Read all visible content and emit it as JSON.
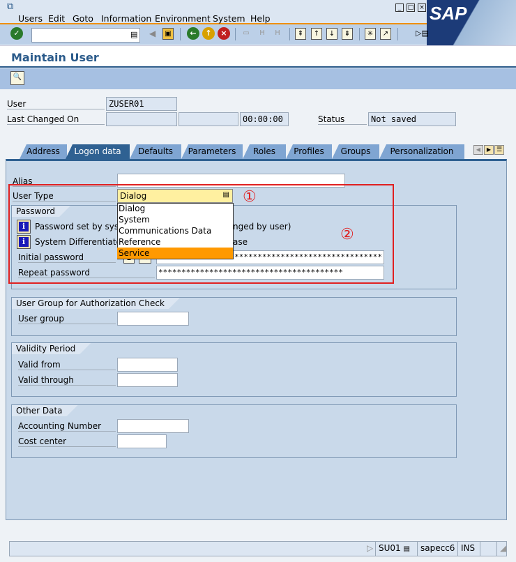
{
  "menu": [
    "Users",
    "Edit",
    "Goto",
    "Information",
    "Environment",
    "System",
    "Help"
  ],
  "logo": "SAP",
  "command_field": "",
  "page_title": "Maintain User",
  "header_fields": {
    "user_label": "User",
    "user_value": "ZUSER01",
    "last_changed_label": "Last Changed On",
    "last_changed_date": "",
    "last_changed_by": "",
    "last_changed_time": "00:00:00",
    "status_label": "Status",
    "status_value": "Not saved"
  },
  "tabs": [
    "Address",
    "Logon data",
    "Defaults",
    "Parameters",
    "Roles",
    "Profiles",
    "Groups",
    "Personalization"
  ],
  "active_tab": "Logon data",
  "logon": {
    "alias_label": "Alias",
    "alias_value": "",
    "user_type_label": "User Type",
    "user_type_value": "Dialog",
    "user_type_options": [
      "Dialog",
      "System",
      "Communications Data",
      "Reference",
      "Service"
    ],
    "highlighted_option": "Service",
    "password_group": "Password",
    "info1_left": "Password set by syste",
    "info1_right": "nged by user)",
    "info2_left": "System Differentiates",
    "info2_right": "ase",
    "initial_pw_label": "Initial password",
    "initial_pw_value": "********************************",
    "repeat_pw_label": "Repeat password",
    "repeat_pw_value": "****************************************"
  },
  "annotations": [
    "①",
    "②"
  ],
  "auth_group": {
    "title": "User Group for Authorization Check",
    "user_group_label": "User group",
    "user_group_value": ""
  },
  "validity": {
    "title": "Validity Period",
    "from_label": "Valid from",
    "from_value": "",
    "through_label": "Valid through",
    "through_value": ""
  },
  "other": {
    "title": "Other Data",
    "acct_label": "Accounting Number",
    "acct_value": "",
    "cost_label": "Cost center",
    "cost_value": ""
  },
  "statusbar": {
    "tcode": "SU01",
    "server": "sapecc6",
    "mode": "INS"
  },
  "colors": {
    "accent_orange": "#f09000",
    "highlight": "#ff9900",
    "annotation_red": "#e02020",
    "tab_active": "#2f6192"
  }
}
